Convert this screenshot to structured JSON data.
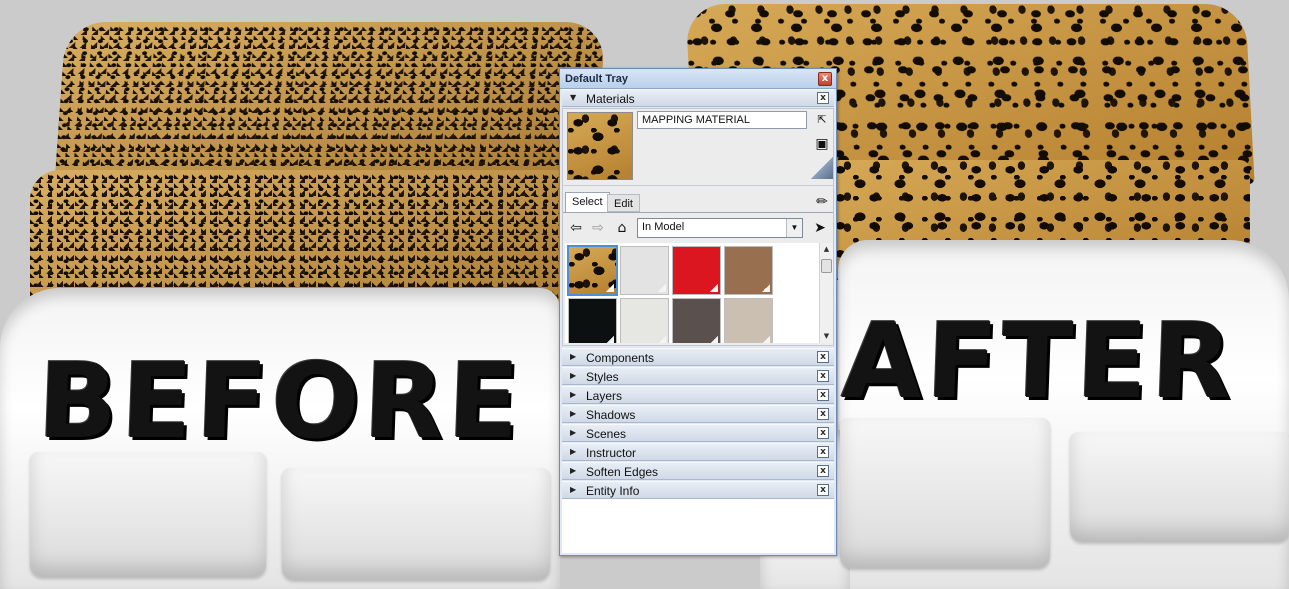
{
  "window": {
    "title": "Default Tray",
    "close_glyph": "x"
  },
  "scene": {
    "left_label": "BEFORE",
    "right_label": "AFTER"
  },
  "materials": {
    "header": "Materials",
    "expanded_arrow": "▼",
    "material_name": "MAPPING MATERIAL",
    "tabs": [
      "Select",
      "Edit"
    ],
    "collection": "In Model",
    "icons": {
      "create": "create-material-icon",
      "details": "details-icon",
      "sample": "sample-paint-icon",
      "eyedropper": "eyedropper-icon",
      "back": "back-arrow-icon",
      "forward": "forward-arrow-icon",
      "home": "home-icon",
      "details_menu": "details-menu-icon"
    },
    "swatches": [
      {
        "name": "leopard",
        "color": "#c79a48",
        "selected": true
      },
      {
        "name": "light-gray",
        "color": "#e3e3e3",
        "selected": false
      },
      {
        "name": "red",
        "color": "#dc1620",
        "selected": false
      },
      {
        "name": "brown",
        "color": "#98704f",
        "selected": false
      },
      {
        "name": "black",
        "color": "#0d1010",
        "selected": false
      },
      {
        "name": "off-white",
        "color": "#e6e6e2",
        "selected": false
      },
      {
        "name": "dark-taupe",
        "color": "#5a514f",
        "selected": false
      },
      {
        "name": "beige",
        "color": "#cbbfb2",
        "selected": false
      }
    ]
  },
  "panels": [
    {
      "label": "Components"
    },
    {
      "label": "Styles"
    },
    {
      "label": "Layers"
    },
    {
      "label": "Shadows"
    },
    {
      "label": "Scenes"
    },
    {
      "label": "Instructor"
    },
    {
      "label": "Soften Edges"
    },
    {
      "label": "Entity Info"
    }
  ],
  "collapsed_arrow": "▶"
}
